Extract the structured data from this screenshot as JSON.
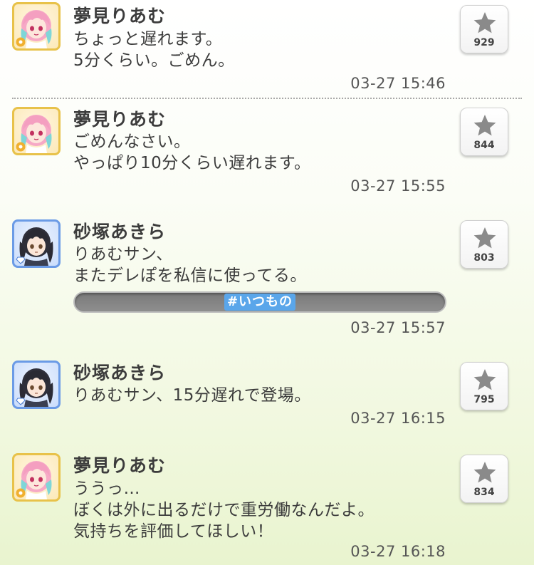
{
  "colors": {
    "riamu_frame": "#e8c24a",
    "akira_frame": "#6b9be6",
    "hashtag_highlight": "#5aa6ea"
  },
  "posts": [
    {
      "author": "夢見りあむ",
      "avatar": "riamu-avatar",
      "lines": [
        "ちょっと遅れます。",
        "5分くらい。ごめん。"
      ],
      "time": "03-27 15:46",
      "fav_count": "929"
    },
    {
      "author": "夢見りあむ",
      "avatar": "riamu-avatar",
      "lines": [
        "ごめんなさい。",
        "やっぱり10分くらい遅れます。"
      ],
      "time": "03-27 15:55",
      "fav_count": "844"
    },
    {
      "author": "砂塚あきら",
      "avatar": "akira-avatar",
      "lines": [
        "りあむサン、",
        "またデレぽを私信に使ってる。"
      ],
      "hashtag": "#いつもの",
      "time": "03-27 15:57",
      "fav_count": "803"
    },
    {
      "author": "砂塚あきら",
      "avatar": "akira-avatar",
      "lines": [
        "りあむサン、15分遅れで登場。"
      ],
      "time": "03-27 16:15",
      "fav_count": "795"
    },
    {
      "author": "夢見りあむ",
      "avatar": "riamu-avatar",
      "lines": [
        "ううっ…",
        "ぼくは外に出るだけで重労働なんだよ。",
        "気持ちを評価してほしい！"
      ],
      "time": "03-27 16:18",
      "fav_count": "834"
    }
  ]
}
